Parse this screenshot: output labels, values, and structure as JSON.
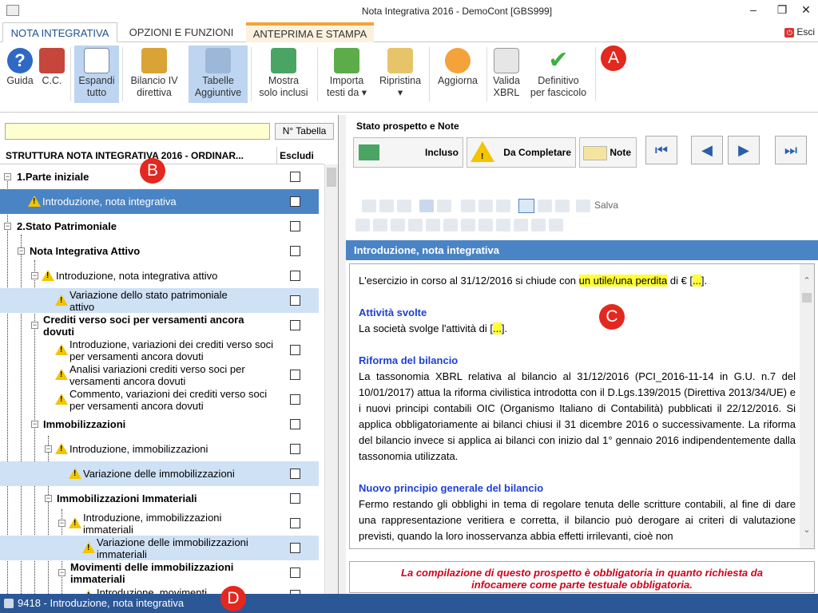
{
  "window": {
    "title": "Nota Integrativa 2016 - DemoCont [GBS999]"
  },
  "tabs": [
    {
      "label": "NOTA INTEGRATIVA"
    },
    {
      "label": "OPZIONI E FUNZIONI"
    },
    {
      "label": "ANTEPRIMA E STAMPA"
    }
  ],
  "esci": "Esci",
  "ribbon": {
    "guida": "Guida",
    "cc": "C.C.",
    "espandi": [
      "Espandi",
      "tutto"
    ],
    "bilancio": [
      "Bilancio IV",
      "direttiva"
    ],
    "tabelle": [
      "Tabelle",
      "Aggiuntive"
    ],
    "mostra": [
      "Mostra",
      "solo inclusi"
    ],
    "importa": [
      "Importa",
      "testi da ▾"
    ],
    "ripristina": [
      "Ripristina",
      "▾"
    ],
    "aggiorna": "Aggiorna",
    "valida": [
      "Valida",
      "XBRL"
    ],
    "definitivo": [
      "Definitivo",
      "per fascicolo"
    ]
  },
  "markers": {
    "a": "A",
    "b": "B",
    "c": "C",
    "d": "D"
  },
  "left": {
    "search_value": "",
    "ntabella": "N° Tabella",
    "col_structure": "STRUTTURA NOTA INTEGRATIVA 2016 - ORDINAR...",
    "col_escludi": "Escludi",
    "rows": [
      {
        "text": "1.Parte iniziale",
        "bold": true
      },
      {
        "text": "Introduzione, nota integrativa"
      },
      {
        "text": "2.Stato Patrimoniale",
        "bold": true
      },
      {
        "text": "Nota Integrativa Attivo",
        "bold": true
      },
      {
        "text": "Introduzione, nota integrativa attivo"
      },
      {
        "text": "Variazione dello stato patrimoniale attivo"
      },
      {
        "text": "Crediti verso soci per versamenti ancora dovuti",
        "bold": true
      },
      {
        "text": "Introduzione, variazioni dei crediti verso soci per versamenti ancora dovuti"
      },
      {
        "text": "Analisi variazioni crediti verso soci per versamenti ancora dovuti"
      },
      {
        "text": "Commento, variazioni dei crediti verso soci per versamenti ancora dovuti"
      },
      {
        "text": "Immobilizzazioni",
        "bold": true
      },
      {
        "text": "Introduzione, immobilizzazioni"
      },
      {
        "text": "Variazione delle immobilizzazioni"
      },
      {
        "text": "Immobilizzazioni Immateriali",
        "bold": true
      },
      {
        "text": "Introduzione, immobilizzazioni immateriali"
      },
      {
        "text": "Variazione delle immobilizzazioni immateriali"
      },
      {
        "text": "Movimenti delle immobilizzazioni immateriali",
        "bold": true
      },
      {
        "text": "Introduzione, movimenti"
      }
    ]
  },
  "right": {
    "stato_label": "Stato prospetto e Note",
    "incluso": "Incluso",
    "da_completare": "Da Completare",
    "note": "Note",
    "salva": "Salva",
    "section_title": "Introduzione, nota integrativa",
    "doc": {
      "p1_a": "L'esercizio in corso al 31/12/2016 si chiude con ",
      "p1_hl": "un utile/una perdita",
      "p1_b": " di € [",
      "p1_dots": "...",
      "p1_c": "].",
      "h1": "Attività svolte",
      "p2_a": "La società svolge l'attività di [",
      "p2_dots": "...",
      "p2_b": "].",
      "h2": "Riforma del bilancio",
      "p3": "La tassonomia XBRL relativa al bilancio al 31/12/2016 (PCI_2016-11-14 in G.U. n.7 del 10/01/2017) attua la riforma civilistica introdotta con il D.Lgs.139/2015 (Direttiva 2013/34/UE) e i nuovi principi contabili OIC (Organismo Italiano di Contabilità) pubblicati il 22/12/2016. Si applica obbligatoriamente ai bilanci chiusi il 31 dicembre 2016 o successivamente. La riforma del bilancio invece si applica ai bilanci con inizio dal 1° gennaio 2016 indipendentemente dalla tassonomia utilizzata.",
      "h3": "Nuovo principio generale del bilancio",
      "p4": "Fermo restando gli obblighi in tema di regolare tenuta delle scritture contabili, al fine di dare una rappresentazione veritiera e corretta, il bilancio può derogare ai criteri di valutazione previsti, quando la loro inosservanza abbia effetti irrilevanti, cioè non"
    },
    "note_text_1": "La compilazione di questo prospetto è obbligatoria in quanto richiesta da",
    "note_text_2": "infocamere come parte testuale obbligatoria."
  },
  "status": {
    "text": "9418 - Introduzione, nota integrativa"
  },
  "colors": {
    "accent": "#4a84c5",
    "status_bar": "#2b5797",
    "marker": "#e3281f",
    "note_red": "#d0021b"
  }
}
